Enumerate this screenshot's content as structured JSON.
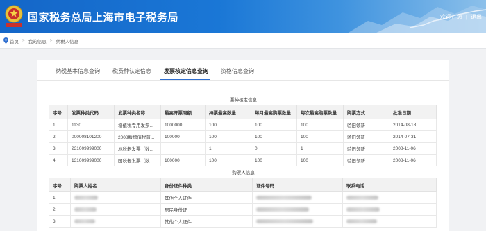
{
  "header": {
    "title": "国家税务总局上海市电子税务局",
    "welcome": "欢迎，您",
    "separator": "|",
    "logout": "退出",
    "emblem_stamp_text": "中国税务"
  },
  "breadcrumb": {
    "items": [
      "首页",
      "我的信息",
      "纳税人信息"
    ],
    "separator": ">"
  },
  "tabs": [
    {
      "label": "纳税基本信息查询",
      "active": false
    },
    {
      "label": "税费种认定信息",
      "active": false
    },
    {
      "label": "发票核定信息查询",
      "active": true
    },
    {
      "label": "资格信息查询",
      "active": false
    }
  ],
  "invoice_section": {
    "title": "票种核定信息",
    "columns": [
      "序号",
      "发票种类代码",
      "发票种类名称",
      "最高开票限额",
      "持票最高数量",
      "每月最高购票数量",
      "每次最高购票数量",
      "购票方式",
      "批准日期"
    ],
    "rows": [
      [
        "1",
        "1130",
        "增值税专用发票...",
        "1000000",
        "100",
        "100",
        "100",
        "验旧领新",
        "2014-08-18"
      ],
      [
        "2",
        "000008101200",
        "2008版增值税普...",
        "100000",
        "100",
        "100",
        "100",
        "验旧领新",
        "2014-07-31"
      ],
      [
        "3",
        "231009999000",
        "地税老发票（数...",
        "",
        "1",
        "0",
        "1",
        "验旧领新",
        "2008-11-06"
      ],
      [
        "4",
        "131009999000",
        "国税老发票（数...",
        "100000",
        "100",
        "100",
        "100",
        "验旧领新",
        "2008-11-06"
      ]
    ]
  },
  "buyer_section": {
    "title": "购票人信息",
    "columns": [
      "序号",
      "购票人姓名",
      "身份证件种类",
      "证件号码",
      "联系电话"
    ],
    "rows": [
      [
        "1",
        "",
        "其他个人证件",
        "",
        ""
      ],
      [
        "2",
        "",
        "居民身份证",
        "",
        ""
      ],
      [
        "3",
        "",
        "其他个人证件",
        "",
        ""
      ]
    ]
  },
  "colors": {
    "header_blue": "#1a77d6",
    "tab_active_underline": "#2f6fd0"
  }
}
